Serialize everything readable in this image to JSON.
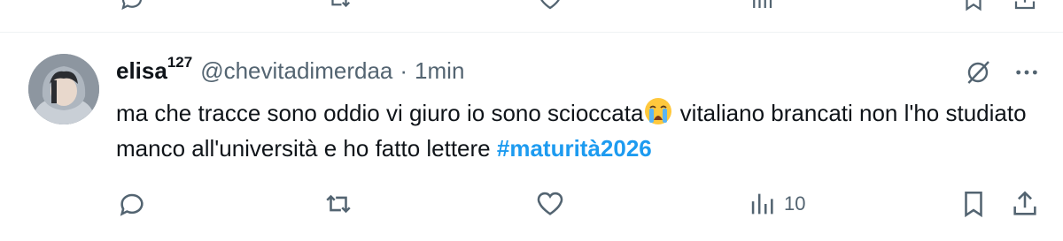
{
  "tweet": {
    "display_name": "elisa",
    "name_superscript": "127",
    "handle": "@chevitadimerdaa",
    "separator": "·",
    "time": "1min",
    "text_part1": "ma che tracce sono oddio vi giuro io sono scioccata",
    "text_part2": " vitaliano brancati non l'ho studiato manco all'università e ho fatto lettere ",
    "hashtag": "#maturità2026",
    "emoji": "loudly-crying-face",
    "avatar": "profile-photo"
  },
  "actions": {
    "reply_icon": "reply-icon",
    "retweet_icon": "retweet-icon",
    "like_icon": "heart-icon",
    "views_icon": "views-icon",
    "views_count": "10",
    "bookmark_icon": "bookmark-icon",
    "share_icon": "share-icon"
  },
  "colors": {
    "text": "#0f1419",
    "secondary": "#536471",
    "accent": "#1d9bf0",
    "divider": "#eff3f4"
  }
}
